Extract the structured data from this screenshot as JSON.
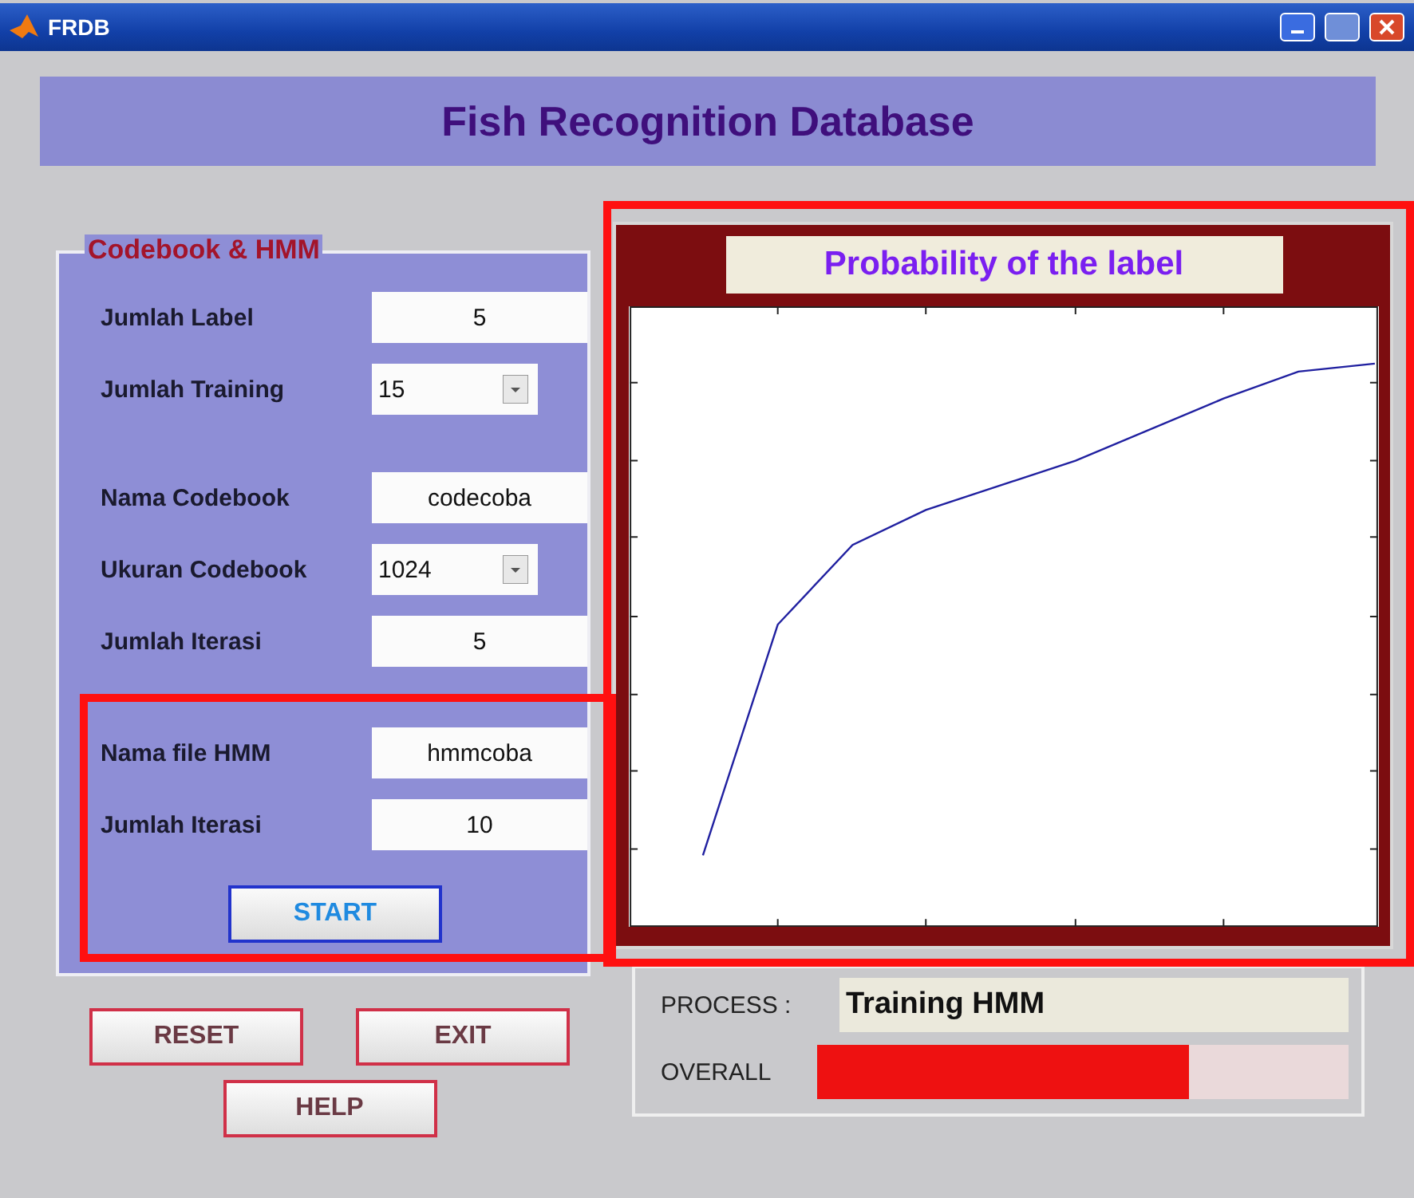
{
  "window": {
    "title": "FRDB"
  },
  "header": {
    "title": "Fish Recognition Database"
  },
  "codebook_panel": {
    "title": "Codebook & HMM",
    "fields_a": [
      {
        "label": "Jumlah Label",
        "kind": "text",
        "value": "5"
      },
      {
        "label": "Jumlah Training",
        "kind": "dropdown",
        "value": "15"
      }
    ],
    "fields_b": [
      {
        "label": "Nama Codebook",
        "kind": "text",
        "value": "codecoba"
      },
      {
        "label": "Ukuran Codebook",
        "kind": "dropdown",
        "value": "1024"
      },
      {
        "label": "Jumlah Iterasi",
        "kind": "text",
        "value": "5"
      }
    ],
    "hmm_fields": [
      {
        "label": "Nama file HMM",
        "kind": "text",
        "value": "hmmcoba"
      },
      {
        "label": "Jumlah Iterasi",
        "kind": "text",
        "value": "10"
      }
    ],
    "start_button": "START"
  },
  "buttons": [
    {
      "label": "RESET"
    },
    {
      "label": "EXIT"
    },
    {
      "label": "HELP"
    }
  ],
  "plot": {
    "title": "Probability of the label"
  },
  "process": {
    "label": "PROCESS :",
    "value": "Training HMM"
  },
  "overall": {
    "label": "OVERALL",
    "level": 0.7
  }
}
